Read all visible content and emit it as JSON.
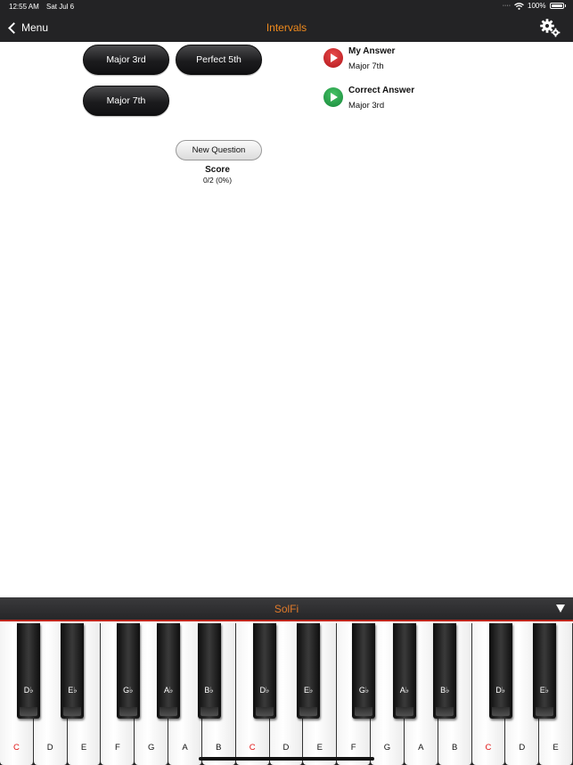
{
  "status": {
    "time": "12:55 AM",
    "date": "Sat Jul 6",
    "battery": "100%"
  },
  "nav": {
    "back_label": "Menu",
    "title": "Intervals"
  },
  "answers": [
    "Major 3rd",
    "Perfect 5th",
    "Major 7th"
  ],
  "new_question_label": "New Question",
  "score": {
    "title": "Score",
    "value": "0/2 (0%)"
  },
  "my_answer": {
    "label": "My Answer",
    "value": "Major 7th"
  },
  "correct_answer": {
    "label": "Correct Answer",
    "value": "Major 3rd"
  },
  "keyboard": {
    "title": "SolFi",
    "white_keys": [
      "C",
      "D",
      "E",
      "F",
      "G",
      "A",
      "B",
      "C",
      "D",
      "E",
      "F",
      "G",
      "A",
      "B",
      "C",
      "D",
      "E"
    ],
    "black_keys": [
      "D♭",
      "E♭",
      "G♭",
      "A♭",
      "B♭",
      "D♭",
      "E♭",
      "G♭",
      "A♭",
      "B♭",
      "D♭",
      "E♭"
    ]
  },
  "colors": {
    "accent": "#f08a1d",
    "bar": "#232325",
    "red": "#e01414"
  }
}
